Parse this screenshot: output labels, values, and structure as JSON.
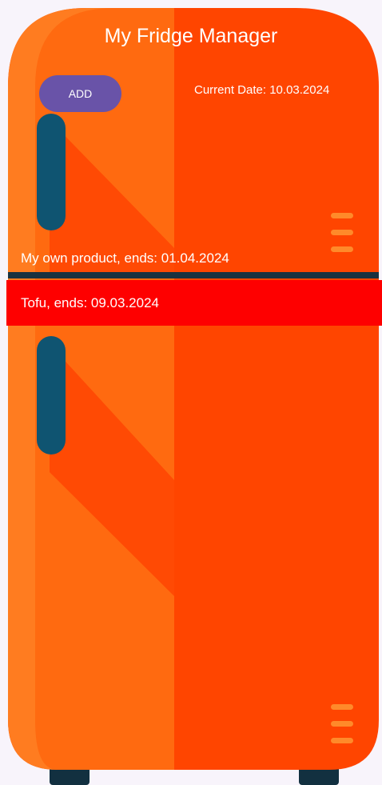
{
  "app": {
    "title": "My Fridge Manager"
  },
  "toolbar": {
    "add_label": "ADD"
  },
  "date": {
    "label": "Current Date: ",
    "value": "10.03.2024"
  },
  "products": [
    {
      "name": "My own product",
      "separator": ", ends: ",
      "ends": "01.04.2024",
      "expired": false
    },
    {
      "name": "Tofu",
      "separator": ", ends: ",
      "ends": "09.03.2024",
      "expired": true
    }
  ],
  "colors": {
    "fridge_body": "#ff4500",
    "fridge_light": "#ff6a10",
    "fridge_edge": "#ff7c20",
    "handle": "#0f5471",
    "door_gap": "#1a3240",
    "add_button": "#6953a8",
    "expired_highlight": "#fe0000",
    "background": "#f8f4fb"
  }
}
